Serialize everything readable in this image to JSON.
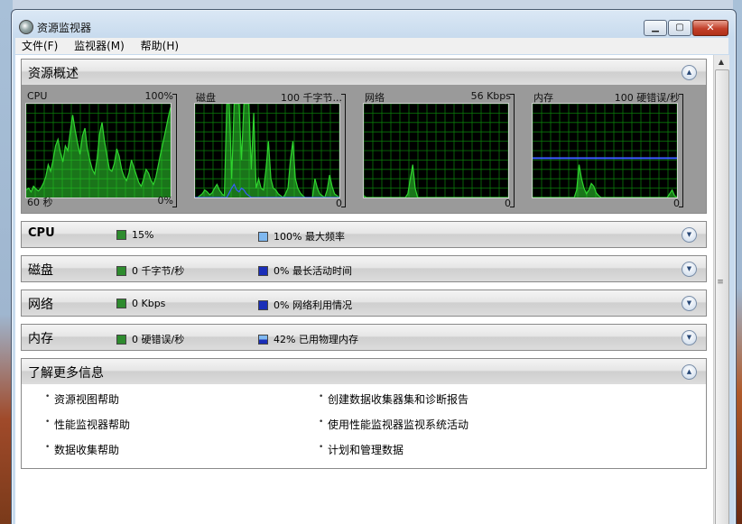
{
  "window": {
    "title": "资源监视器"
  },
  "menu": [
    "文件(F)",
    "监视器(M)",
    "帮助(H)"
  ],
  "overview": {
    "title": "资源概述",
    "graphs": [
      {
        "name": "CPU",
        "max": "100%",
        "time": "60 秒",
        "min": "0%",
        "color": "#2fd52f",
        "samples": [
          8,
          10,
          6,
          12,
          9,
          7,
          10,
          15,
          22,
          35,
          28,
          40,
          55,
          62,
          48,
          38,
          55,
          50,
          70,
          88,
          72,
          58,
          46,
          66,
          74,
          52,
          40,
          30,
          25,
          42,
          68,
          80,
          60,
          45,
          30,
          28,
          36,
          52,
          44,
          30,
          22,
          18,
          26,
          40,
          32,
          24,
          16,
          12,
          20,
          30,
          26,
          18,
          14,
          22,
          35,
          48,
          60,
          72,
          85,
          96
        ]
      },
      {
        "name": "磁盘",
        "max": "100 千字节...",
        "time": "",
        "min": "0",
        "color": "#2fd52f",
        "samples": [
          0,
          0,
          2,
          4,
          8,
          6,
          3,
          5,
          10,
          14,
          8,
          4,
          2,
          100,
          100,
          20,
          100,
          100,
          100,
          40,
          100,
          100,
          100,
          30,
          90,
          10,
          20,
          10,
          8,
          30,
          60,
          20,
          10,
          8,
          4,
          2,
          0,
          4,
          10,
          40,
          60,
          20,
          10,
          5,
          2,
          0,
          0,
          0,
          0,
          20,
          10,
          4,
          2,
          0,
          8,
          24,
          12,
          4,
          2,
          0
        ],
        "secondary": [
          0,
          0,
          0,
          0,
          0,
          0,
          0,
          0,
          0,
          0,
          0,
          0,
          0,
          0,
          5,
          10,
          14,
          8,
          6,
          10,
          8,
          4,
          2,
          0,
          0,
          0,
          0,
          0,
          0,
          0,
          0,
          0,
          0,
          0,
          0,
          0,
          0,
          0,
          0,
          0,
          0,
          0,
          0,
          0,
          0,
          0,
          0,
          0,
          0,
          0,
          0,
          0,
          0,
          0,
          0,
          0,
          0,
          0,
          0,
          0
        ],
        "secondary_color": "#3a5cff"
      },
      {
        "name": "网络",
        "max": "56 Kbps",
        "time": "",
        "min": "0",
        "color": "#2fd52f",
        "samples": [
          2,
          0,
          0,
          0,
          0,
          0,
          0,
          0,
          0,
          0,
          0,
          0,
          0,
          0,
          0,
          0,
          0,
          0,
          4,
          20,
          35,
          10,
          0,
          0,
          0,
          0,
          0,
          0,
          0,
          0,
          0,
          0,
          0,
          0,
          0,
          0,
          0,
          0,
          0,
          0,
          0,
          0,
          0,
          0,
          0,
          0,
          0,
          0,
          0,
          0,
          0,
          0,
          0,
          0,
          0,
          0,
          0,
          0,
          0,
          0
        ]
      },
      {
        "name": "内存",
        "max": "100 硬错误/秒",
        "time": "",
        "min": "0",
        "color": "#2fd52f",
        "samples": [
          0,
          0,
          0,
          0,
          0,
          0,
          0,
          0,
          0,
          0,
          0,
          0,
          0,
          0,
          0,
          0,
          0,
          0,
          8,
          35,
          20,
          10,
          4,
          8,
          15,
          12,
          5,
          2,
          0,
          0,
          0,
          0,
          0,
          0,
          0,
          0,
          0,
          0,
          0,
          0,
          0,
          0,
          0,
          0,
          0,
          0,
          0,
          0,
          0,
          0,
          0,
          0,
          0,
          0,
          0,
          0,
          4,
          8,
          2,
          0
        ],
        "line": 42,
        "line_color": "#3a5cff"
      }
    ]
  },
  "rows": [
    {
      "title": "CPU",
      "bold": true,
      "left_value": "15%",
      "left_color": "#2e8b2e",
      "right_value": "100% 最大频率",
      "right_color": "#7fb8f0"
    },
    {
      "title": "磁盘",
      "bold": false,
      "left_value": "0 千字节/秒",
      "left_color": "#2e8b2e",
      "right_value": "0% 最长活动时间",
      "right_color": "#1a2eb8"
    },
    {
      "title": "网络",
      "bold": false,
      "left_value": "0 Kbps",
      "left_color": "#2e8b2e",
      "right_value": "0% 网络利用情况",
      "right_color": "#1a2eb8"
    },
    {
      "title": "内存",
      "bold": false,
      "left_value": "0 硬错误/秒",
      "left_color": "#2e8b2e",
      "right_value": "42% 已用物理内存",
      "right_color": "#1a2eb8"
    }
  ],
  "info": {
    "title": "了解更多信息",
    "links_left": [
      "资源视图帮助",
      "性能监视器帮助",
      "数据收集帮助"
    ],
    "links_right": [
      "创建数据收集器集和诊断报告",
      "使用性能监视器监视系统活动",
      "计划和管理数据"
    ]
  }
}
